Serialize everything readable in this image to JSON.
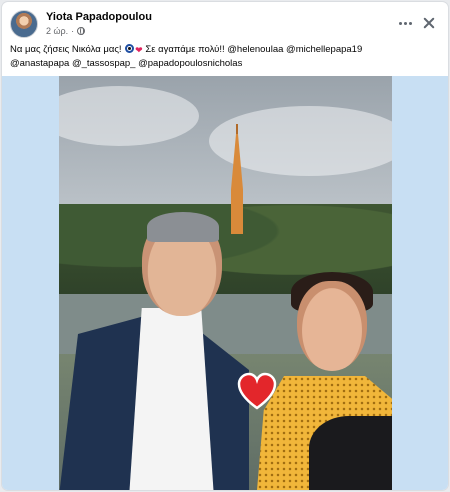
{
  "post": {
    "author": "Yiota Papadopoulou",
    "time": "2 ώρ.",
    "separator": "·",
    "privacy_icon": "globe-icon",
    "caption_text_1": "Να μας ζήσεις Νικόλα μας! ",
    "caption_text_2": " Σε αγαπάμε πολύ!! ",
    "emoji_1": "nazar-amulet",
    "emoji_2": "heart",
    "mentions": [
      "@helenoulaa",
      "@michellepapa19",
      "@anastapapa",
      "@_tassospap_",
      "@papadopoulosnicholas"
    ]
  },
  "actions": {
    "more_icon": "more-horizontal-icon",
    "close_icon": "close-icon"
  },
  "colors": {
    "text": "#050505",
    "meta": "#65676b",
    "photo_bg": "#c8dff3"
  }
}
